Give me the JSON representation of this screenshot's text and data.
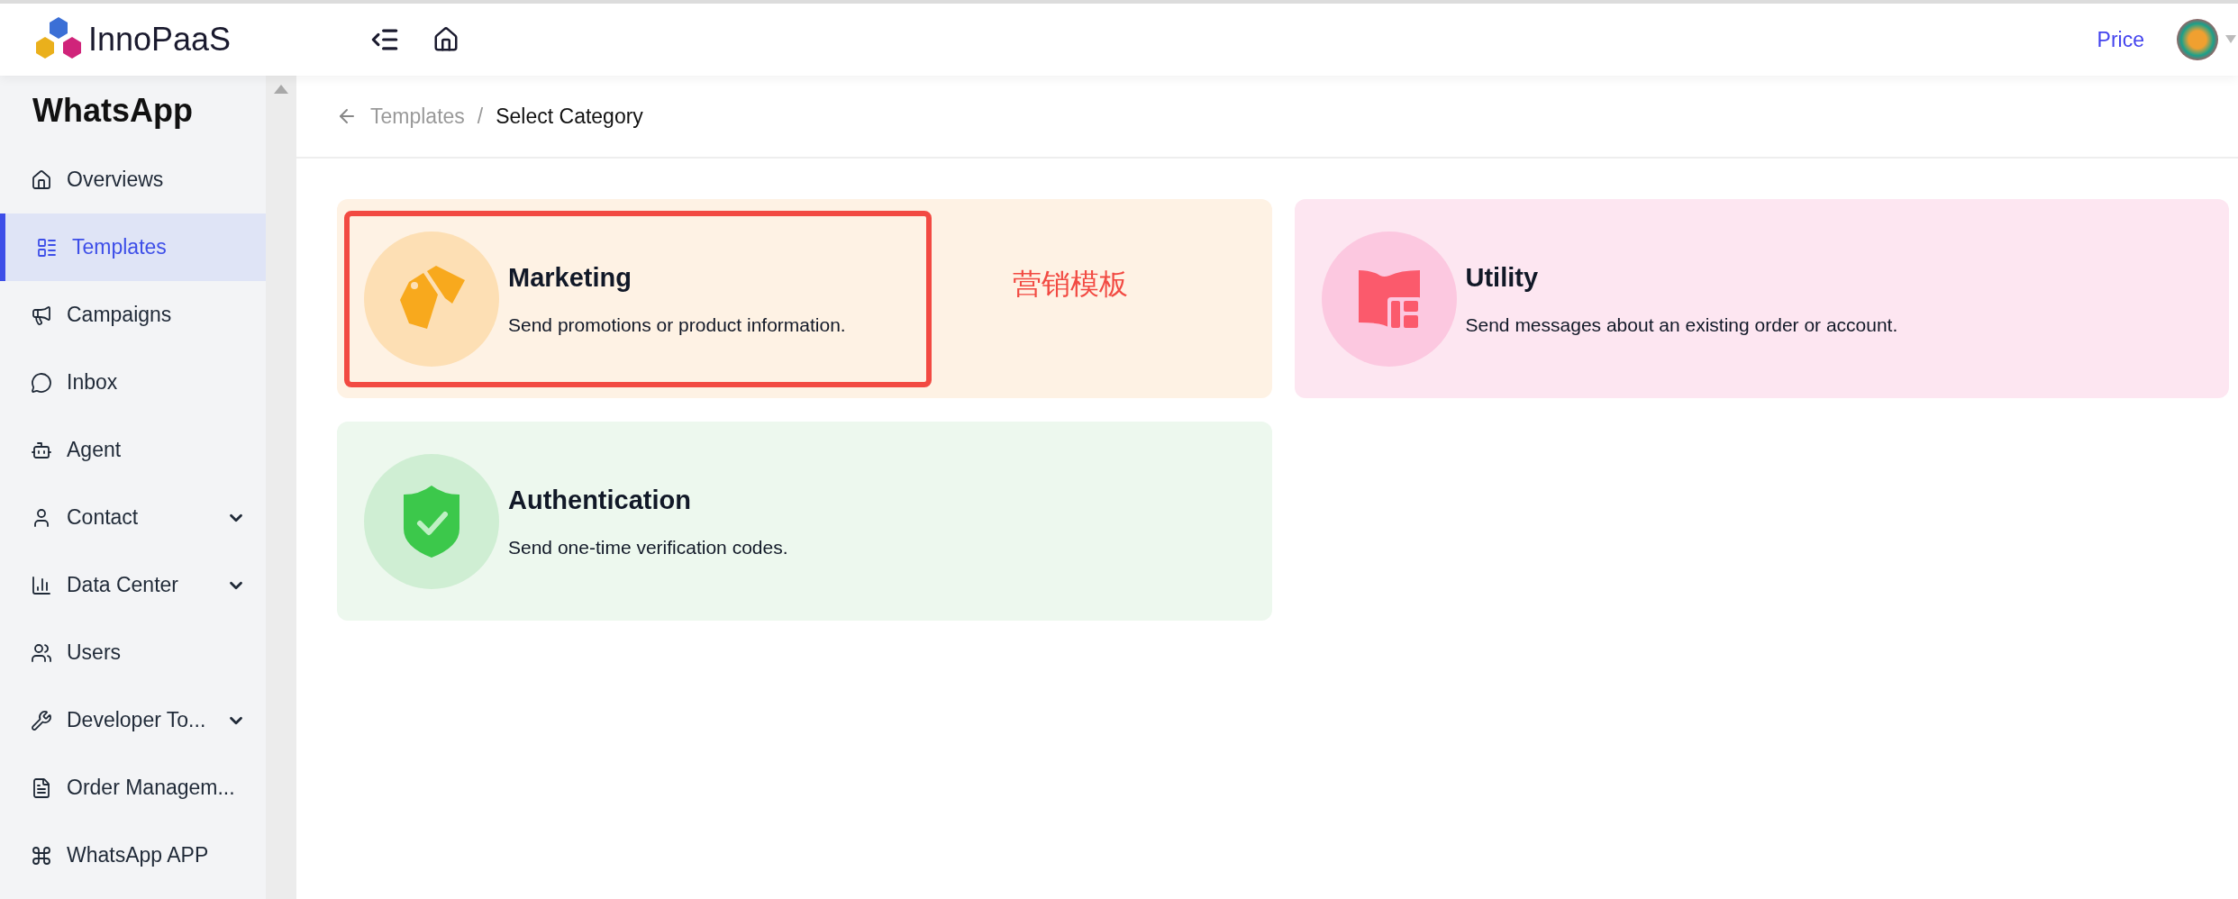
{
  "header": {
    "logo_text": "InnoPaaS",
    "price_link": "Price"
  },
  "sidebar": {
    "title": "WhatsApp",
    "items": [
      {
        "label": "Overviews",
        "selected": false,
        "expandable": false
      },
      {
        "label": "Templates",
        "selected": true,
        "expandable": false
      },
      {
        "label": "Campaigns",
        "selected": false,
        "expandable": false
      },
      {
        "label": "Inbox",
        "selected": false,
        "expandable": false
      },
      {
        "label": "Agent",
        "selected": false,
        "expandable": false
      },
      {
        "label": "Contact",
        "selected": false,
        "expandable": true
      },
      {
        "label": "Data Center",
        "selected": false,
        "expandable": true
      },
      {
        "label": "Users",
        "selected": false,
        "expandable": false
      },
      {
        "label": "Developer To...",
        "selected": false,
        "expandable": true
      },
      {
        "label": "Order Managem...",
        "selected": false,
        "expandable": false
      },
      {
        "label": "WhatsApp APP",
        "selected": false,
        "expandable": false
      }
    ]
  },
  "breadcrumb": [
    {
      "label": "Templates"
    },
    {
      "label": "Select Category"
    }
  ],
  "breadcrumb_separator": "/",
  "cards": [
    {
      "kind": "marketing",
      "title": "Marketing",
      "description": "Send promotions or product information.",
      "highlighted": true,
      "note": "营销模板"
    },
    {
      "kind": "utility",
      "title": "Utility",
      "description": "Send messages about an existing order or account.",
      "highlighted": false
    },
    {
      "kind": "authentication",
      "title": "Authentication",
      "description": "Send one-time verification codes.",
      "highlighted": false
    }
  ]
}
